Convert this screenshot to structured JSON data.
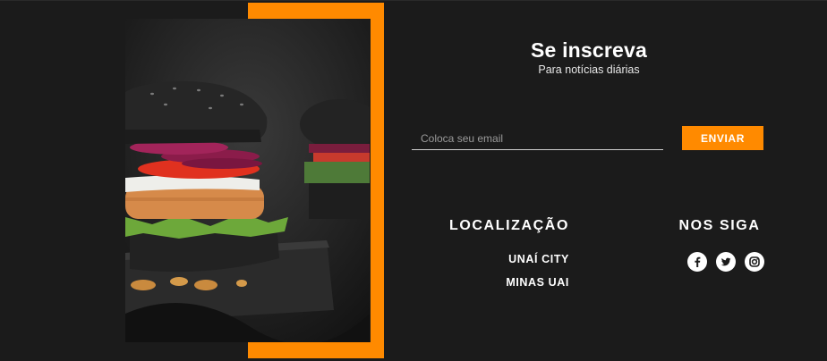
{
  "newsletter": {
    "title": "Se inscreva",
    "subtitle": "Para notícias diárias",
    "email_placeholder": "Coloca seu email",
    "email_value": "",
    "submit_label": "ENVIAR"
  },
  "location": {
    "heading": "LOCALIZAÇÃO",
    "items": [
      "UNAÍ CITY",
      "MINAS UAI"
    ]
  },
  "follow": {
    "heading": "NOS SIGA",
    "icons": [
      "facebook-icon",
      "twitter-icon",
      "instagram-icon"
    ]
  },
  "colors": {
    "background": "#1b1b1b",
    "accent": "#ff8a00",
    "text": "#ffffff"
  }
}
